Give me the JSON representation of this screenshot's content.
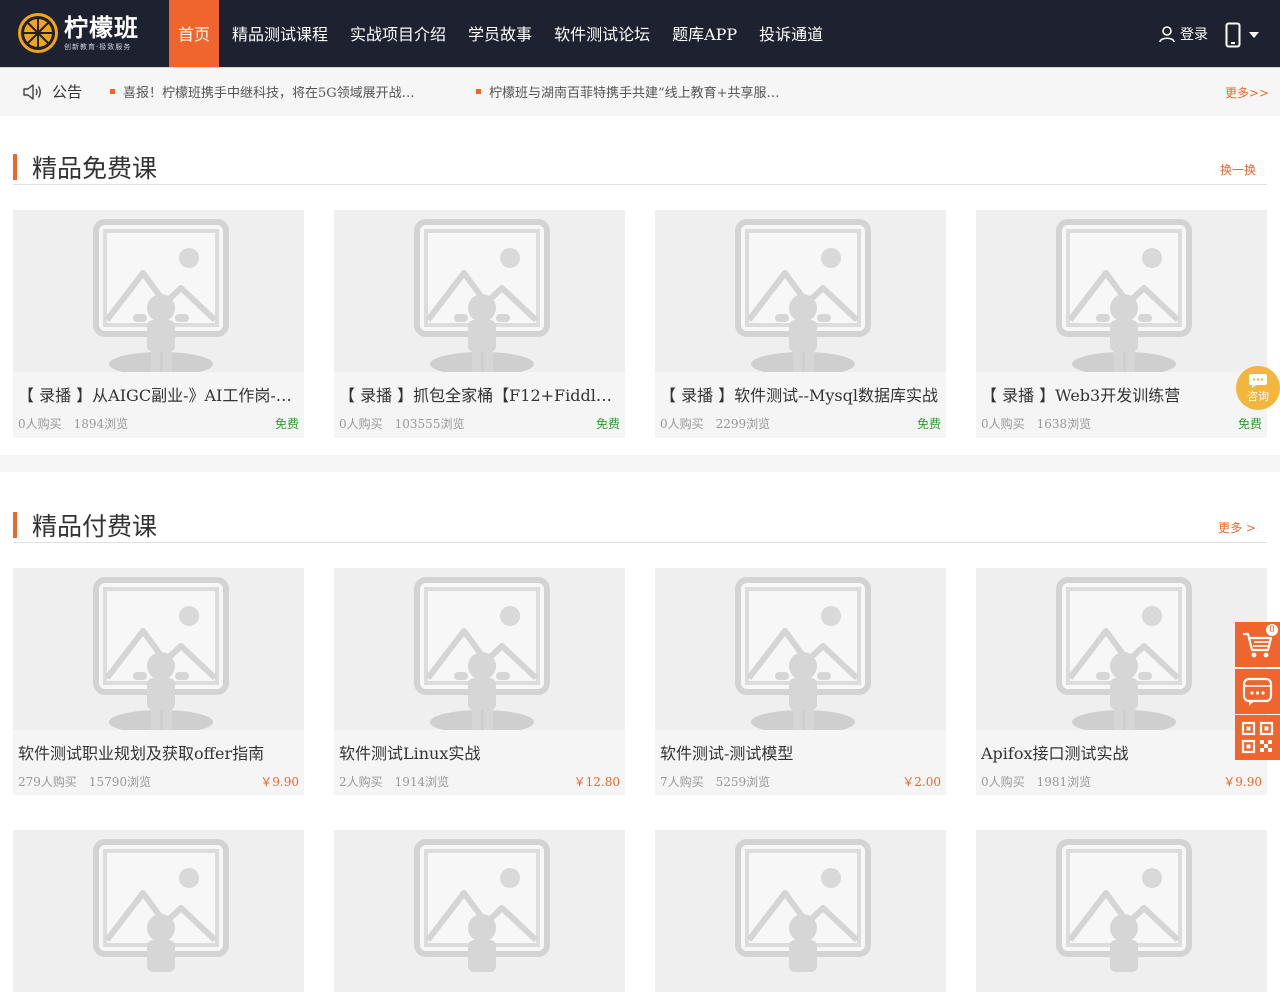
{
  "header": {
    "logo_name": "柠檬班",
    "logo_slogan": "创新教育·极致服务",
    "nav": [
      "首页",
      "精品测试课程",
      "实战项目介绍",
      "学员故事",
      "软件测试论坛",
      "题库APP",
      "投诉通道"
    ],
    "login_label": "登录"
  },
  "notice": {
    "label": "公告",
    "items": [
      "喜报！柠檬班携手中继科技，将在5G领域展开战…",
      "柠檬班与湖南百菲特携手共建“线上教育+共享服…"
    ],
    "more": "更多>>"
  },
  "free_section": {
    "title": "精品免费课",
    "link": "换一换",
    "cards": [
      {
        "title": "【 录播 】从AIGC副业-》AI工作岗-…",
        "buyers": "0人购买",
        "views": "1894浏览",
        "price": "免费"
      },
      {
        "title": "【 录播 】抓包全家桶【F12+Fiddler+…",
        "buyers": "0人购买",
        "views": "103555浏览",
        "price": "免费"
      },
      {
        "title": "【 录播 】软件测试--Mysql数据库实战",
        "buyers": "0人购买",
        "views": "2299浏览",
        "price": "免费"
      },
      {
        "title": "【 录播 】Web3开发训练营",
        "buyers": "0人购买",
        "views": "1638浏览",
        "price": "免费"
      }
    ]
  },
  "paid_section": {
    "title": "精品付费课",
    "link": "更多 >",
    "cards": [
      {
        "title": "软件测试职业规划及获取offer指南",
        "buyers": "279人购买",
        "views": "15790浏览",
        "price": "￥9.90"
      },
      {
        "title": "软件测试Linux实战",
        "buyers": "2人购买",
        "views": "1914浏览",
        "price": "￥12.80"
      },
      {
        "title": "软件测试-测试模型",
        "buyers": "7人购买",
        "views": "5259浏览",
        "price": "￥2.00"
      },
      {
        "title": "Apifox接口测试实战",
        "buyers": "0人购买",
        "views": "1981浏览",
        "price": "￥9.90"
      }
    ]
  },
  "floating": {
    "consult_label": "咨询",
    "cart_count": "0"
  },
  "colors": {
    "accent": "#f0652d",
    "nav_bg": "#1e2230",
    "free": "#2e9c2e",
    "consult": "#f2b53d"
  }
}
